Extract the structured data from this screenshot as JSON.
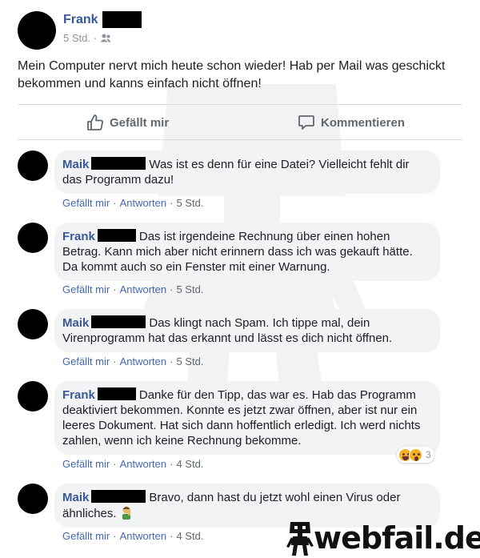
{
  "post": {
    "author": "Frank",
    "time": "5 Std.",
    "privacy_icon": "friends-icon",
    "text": "Mein Computer nervt mich heute schon wieder! Hab per Mail was geschickt bekommen und kanns einfach nicht öffnen!"
  },
  "actions": {
    "like_label": "Gefällt mir",
    "like_icon": "thumbs-up-icon",
    "comment_label": "Kommentieren",
    "comment_icon": "speech-bubble-icon"
  },
  "comments": [
    {
      "author": "Maik",
      "text": "Was ist es denn für eine Datei? Vielleicht fehlt dir das Programm dazu!",
      "like_label": "Gefällt mir",
      "reply_label": "Antworten",
      "time": "5 Std."
    },
    {
      "author": "Frank",
      "text": "Das ist irgendeine Rechnung über einen hohen Betrag. Kann mich aber nicht erinnern dass ich was gekauft hätte. Da kommt auch so ein Fenster mit einer Warnung.",
      "like_label": "Gefällt mir",
      "reply_label": "Antworten",
      "time": "5 Std."
    },
    {
      "author": "Maik",
      "text": "Das klingt nach Spam. Ich tippe mal, dein Virenprogramm hat das erkannt und lässt es dich nicht öffnen.",
      "like_label": "Gefällt mir",
      "reply_label": "Antworten",
      "time": "5 Std."
    },
    {
      "author": "Frank",
      "text": "Danke für den Tipp, das war es. Hab das Programm deaktiviert bekommen. Konnte es jetzt zwar öffnen, aber ist nur ein leeres Dokument. Hat sich dann hoffentlich erledigt. Ich werd nichts zahlen, wenn ich keine Rechnung bekomme.",
      "like_label": "Gefällt mir",
      "reply_label": "Antworten",
      "time": "4 Std.",
      "reactions": {
        "icons": [
          "haha-emoji-icon",
          "wow-emoji-icon"
        ],
        "count": "3"
      }
    },
    {
      "author": "Maik",
      "text": "Bravo, dann hast du jetzt wohl einen Virus oder ähnliches.",
      "inline_icon": "facepalm-emoji-icon",
      "like_label": "Gefällt mir",
      "reply_label": "Antworten",
      "time": "4 Std."
    }
  ],
  "watermark": {
    "logo_text": "webfail.de",
    "logo_icon": "webfail-mascot-icon"
  },
  "colors": {
    "author_link": "#385898",
    "action_link": "#4267b2",
    "bubble_bg": "#f2f3f5",
    "meta_gray": "#606770"
  }
}
